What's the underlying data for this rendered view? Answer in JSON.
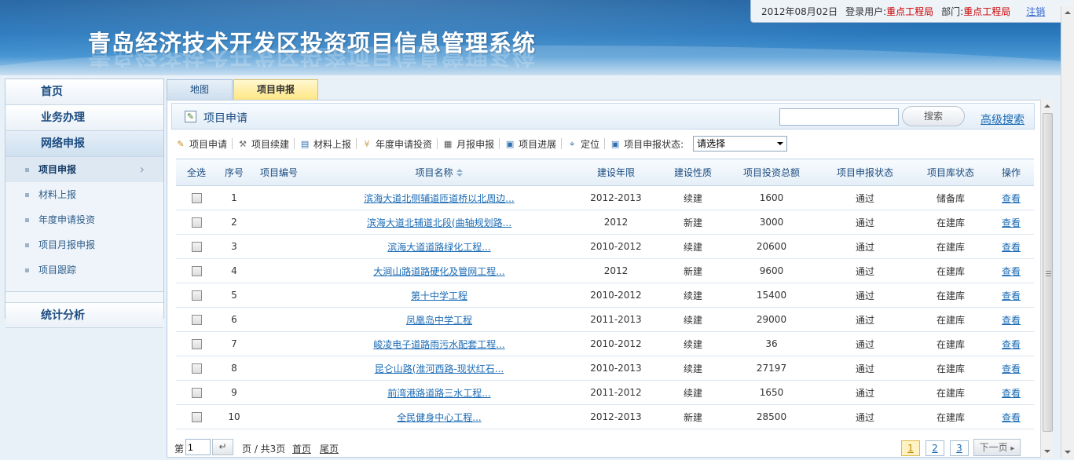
{
  "header": {
    "system_title": "青岛经济技术开发区投资项目信息管理系统",
    "date": "2012年08月02日",
    "login_label": "登录用户:",
    "login_user": "重点工程局",
    "dept_label": "部门:",
    "dept": "重点工程局",
    "logout": "注销"
  },
  "sidebar": {
    "home": "首页",
    "business": "业务办理",
    "online": "网络申报",
    "sub_items": [
      "项目申报",
      "材料上报",
      "年度申请投资",
      "项目月报申报",
      "项目跟踪"
    ],
    "stats": "统计分析"
  },
  "tabs": [
    "地图",
    "项目申报"
  ],
  "panel": {
    "title": "项目申请",
    "search_value": "",
    "search_button": "搜索",
    "advanced_search": "高级搜索"
  },
  "toolbar": {
    "items": [
      "项目申请",
      "项目续建",
      "材料上报",
      "年度申请投资",
      "月报申报",
      "项目进展",
      "定位"
    ],
    "status_label": "项目申报状态:",
    "status_selected": "请选择"
  },
  "table": {
    "headers": [
      "全选",
      "序号",
      "项目编号",
      "项目名称",
      "建设年限",
      "建设性质",
      "项目投资总额",
      "项目申报状态",
      "项目库状态",
      "操作"
    ],
    "rows": [
      {
        "no": "1",
        "code": "",
        "name": "滨海大道北侧辅道匝道桥以北周边...",
        "years": "2012-2013",
        "nature": "续建",
        "amount": "1600",
        "apply_status": "通过",
        "lib_status": "储备库",
        "op": "查看"
      },
      {
        "no": "2",
        "code": "",
        "name": "滨海大道北辅道北段(曲轴规划路...",
        "years": "2012",
        "nature": "新建",
        "amount": "3000",
        "apply_status": "通过",
        "lib_status": "在建库",
        "op": "查看"
      },
      {
        "no": "3",
        "code": "",
        "name": "滨海大道道路绿化工程...",
        "years": "2010-2012",
        "nature": "续建",
        "amount": "20600",
        "apply_status": "通过",
        "lib_status": "在建库",
        "op": "查看"
      },
      {
        "no": "4",
        "code": "",
        "name": "大涧山路道路硬化及管网工程...",
        "years": "2012",
        "nature": "新建",
        "amount": "9600",
        "apply_status": "通过",
        "lib_status": "在建库",
        "op": "查看"
      },
      {
        "no": "5",
        "code": "",
        "name": "第十中学工程",
        "years": "2010-2012",
        "nature": "续建",
        "amount": "15400",
        "apply_status": "通过",
        "lib_status": "在建库",
        "op": "查看"
      },
      {
        "no": "6",
        "code": "",
        "name": "凤凰岛中学工程",
        "years": "2011-2013",
        "nature": "续建",
        "amount": "29000",
        "apply_status": "通过",
        "lib_status": "在建库",
        "op": "查看"
      },
      {
        "no": "7",
        "code": "",
        "name": "峻凌电子道路雨污水配套工程...",
        "years": "2010-2012",
        "nature": "续建",
        "amount": "36",
        "apply_status": "通过",
        "lib_status": "在建库",
        "op": "查看"
      },
      {
        "no": "8",
        "code": "",
        "name": "昆仑山路(淮河西路-现状红石...",
        "years": "2010-2013",
        "nature": "续建",
        "amount": "27197",
        "apply_status": "通过",
        "lib_status": "在建库",
        "op": "查看"
      },
      {
        "no": "9",
        "code": "",
        "name": "前湾港路道路三水工程...",
        "years": "2011-2012",
        "nature": "续建",
        "amount": "1650",
        "apply_status": "通过",
        "lib_status": "在建库",
        "op": "查看"
      },
      {
        "no": "10",
        "code": "",
        "name": "全民健身中心工程...",
        "years": "2012-2013",
        "nature": "新建",
        "amount": "28500",
        "apply_status": "通过",
        "lib_status": "在建库",
        "op": "查看"
      }
    ]
  },
  "pager": {
    "di_label": "第",
    "page_value": "1",
    "total": "页 / 共3页",
    "first": "首页",
    "last": "尾页",
    "pages": [
      "1",
      "2",
      "3"
    ],
    "next": "下一页"
  }
}
